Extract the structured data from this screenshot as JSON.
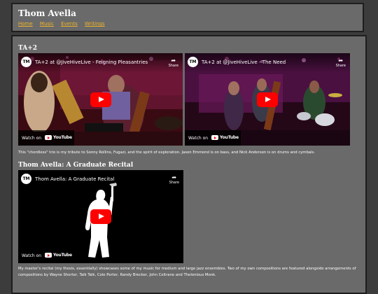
{
  "header": {
    "title": "Thom Avella",
    "nav": [
      "Home",
      "Music",
      "Events",
      "Writings"
    ]
  },
  "sections": [
    {
      "title": "TA+2",
      "videos": [
        {
          "title": "TA+2 at @JiveHiveLive - Feigning Pleasantries",
          "channel_icon": "TM",
          "share": "Share",
          "watch": "Watch on",
          "yt": "YouTube"
        },
        {
          "title": "TA+2 at @JiveHiveLive - The Need",
          "channel_icon": "TM",
          "share": "Share",
          "watch": "Watch on",
          "yt": "YouTube"
        }
      ],
      "description": "This \"chordless\" trio is my tribute to Sonny Rollins, Fugazi, and the spirit of exploration. Jason Emmond is on bass, and Nick Anderson is on drums and cymbals."
    },
    {
      "title": "Thom Avella: A Graduate Recital",
      "videos": [
        {
          "title": "Thom Avella: A Graduate Recital",
          "channel_icon": "TM",
          "share": "Share",
          "watch": "Watch on",
          "yt": "YouTube"
        }
      ],
      "description": "My master's recital (my thesis, essentially) showcases some of my music for medium and large jazz ensembles. Two of my own compositions are featured alongside arrangements of compositions by Wayne Shorter, Talk Talk, Cole Porter, Randy Brecker, John Coltrane and Thelonious Monk."
    }
  ],
  "colors": {
    "page_bg": "#3c3c3c",
    "panel_bg": "#6a6a6a",
    "panel_border": "#1e1e1e",
    "link": "#f0b429",
    "play_button": "#ff0000"
  }
}
